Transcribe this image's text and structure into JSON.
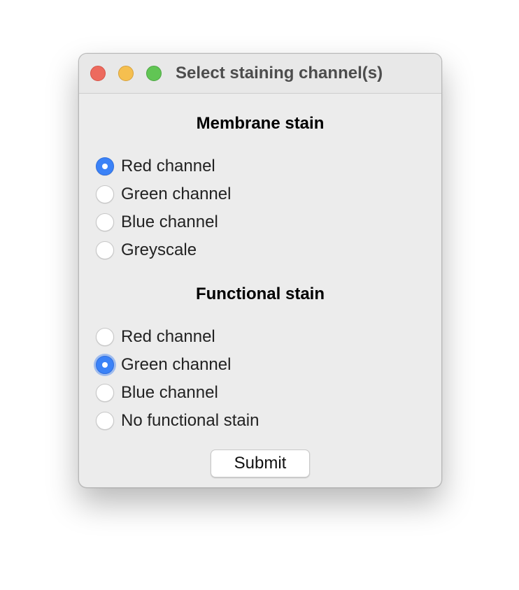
{
  "window": {
    "title": "Select staining channel(s)"
  },
  "membrane": {
    "heading": "Membrane stain",
    "options": [
      {
        "label": "Red channel",
        "selected": true
      },
      {
        "label": "Green channel",
        "selected": false
      },
      {
        "label": "Blue channel",
        "selected": false
      },
      {
        "label": "Greyscale",
        "selected": false
      }
    ]
  },
  "functional": {
    "heading": "Functional stain",
    "options": [
      {
        "label": "Red channel",
        "selected": false
      },
      {
        "label": "Green channel",
        "selected": true
      },
      {
        "label": "Blue channel",
        "selected": false
      },
      {
        "label": "No functional stain",
        "selected": false
      }
    ]
  },
  "submit_label": "Submit",
  "colors": {
    "accent": "#3b82f7",
    "close": "#ed6a5e",
    "minimize": "#f5bf4f",
    "maximize": "#61c554",
    "window_bg": "#ececec"
  }
}
